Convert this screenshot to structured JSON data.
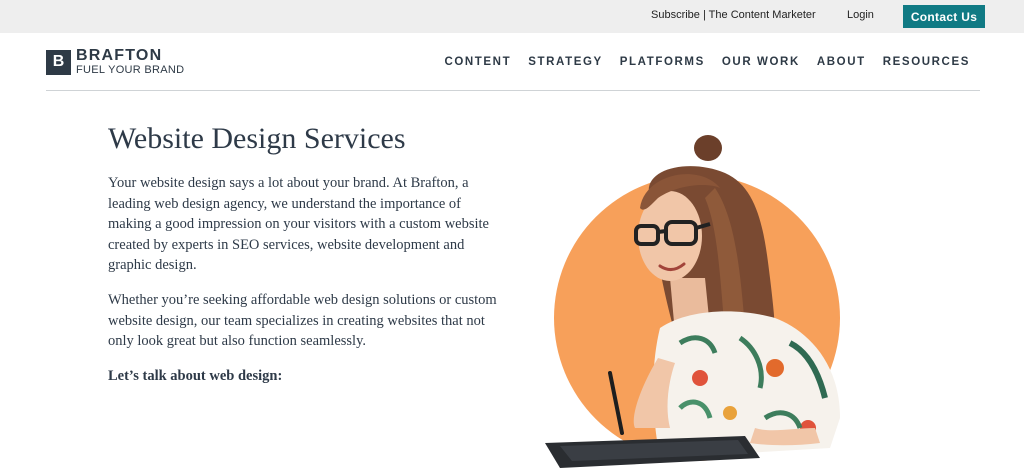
{
  "utility_bar": {
    "subscribe_link": "Subscribe | The Content Marketer",
    "login_link": "Login",
    "contact_button": "Contact Us"
  },
  "header": {
    "logo": {
      "mark": "B",
      "name": "BRAFTON",
      "tagline": "FUEL YOUR BRAND"
    },
    "nav": [
      "CONTENT",
      "STRATEGY",
      "PLATFORMS",
      "OUR WORK",
      "ABOUT",
      "RESOURCES"
    ]
  },
  "main": {
    "title": "Website Design Services",
    "paragraphs": [
      "Your website design says a lot about your brand. At Brafton, a leading web design agency, we understand the importance of making a good impression on your visitors with a custom website created by experts in SEO services, website development and graphic design.",
      "Whether you’re seeking affordable web design solutions or custom website design, our team specializes in creating websites that not only look great but also function seamlessly."
    ],
    "cta_label": "Let’s talk about web design:"
  },
  "colors": {
    "accent": "#107a84",
    "hero_circle": "#f7a05a",
    "text": "#2e3a48",
    "topbar_bg": "#eeeeee"
  }
}
